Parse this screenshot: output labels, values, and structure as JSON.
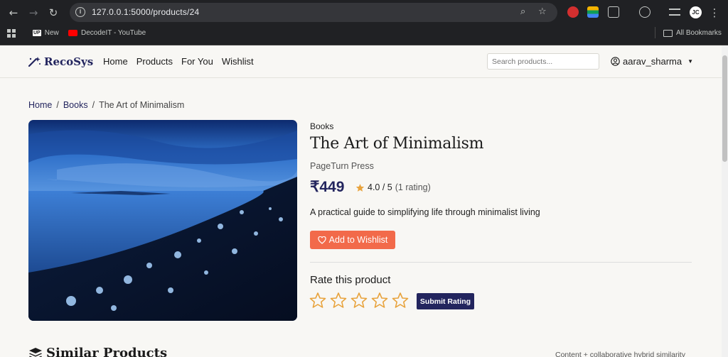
{
  "browser": {
    "url": "127.0.0.1:5000/products/24",
    "avatar_initials": "JC",
    "bookmarks": [
      {
        "label": "New",
        "badge": "UP"
      },
      {
        "label": "DecodeIT - YouTube"
      }
    ],
    "all_bookmarks_label": "All Bookmarks"
  },
  "navbar": {
    "brand": "RecoSys",
    "links": [
      "Home",
      "Products",
      "For You",
      "Wishlist"
    ],
    "search_placeholder": "Search products...",
    "username": "aarav_sharma"
  },
  "breadcrumb": {
    "home": "Home",
    "category": "Books",
    "current": "The Art of Minimalism",
    "separator": "/"
  },
  "product": {
    "category": "Books",
    "title": "The Art of Minimalism",
    "publisher": "PageTurn Press",
    "price": "₹449",
    "rating_value": "4.0 / 5",
    "rating_count": "(1 rating)",
    "description": "A practical guide to simplifying life through minimalist living",
    "wishlist_label": "Add to Wishlist"
  },
  "rating_form": {
    "title": "Rate this product",
    "star_count": 5,
    "submit_label": "Submit Rating"
  },
  "similar": {
    "title": "Similar Products",
    "note": "Content + collaborative hybrid similarity"
  },
  "colors": {
    "brand": "#23255e",
    "accent": "#f26a4a",
    "star": "#e8a33d"
  }
}
